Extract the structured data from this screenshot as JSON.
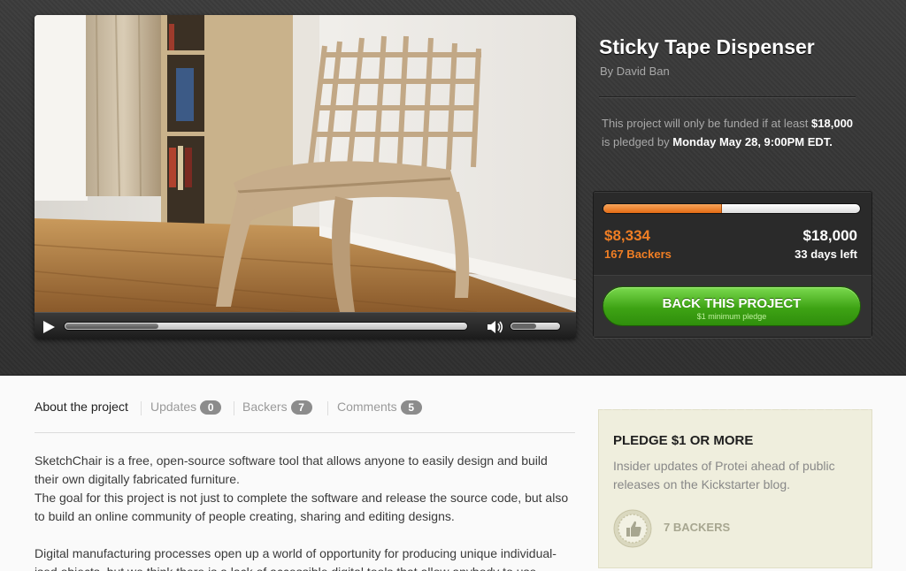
{
  "project": {
    "title": "Sticky Tape Dispenser",
    "author": "By David Ban",
    "funding_note": {
      "prefix": "This project will only be funded if at least",
      "goal_amount": "$18,000",
      "middle": "is pledged by",
      "deadline": "Monday May 28, 9:00PM EDT."
    }
  },
  "video": {
    "progress": 0.23,
    "volume": 0.5,
    "icons": {
      "play": "play-icon",
      "volume": "speaker-icon"
    }
  },
  "stats": {
    "funded_fraction": 0.463,
    "pledged": "$8,334",
    "backers": "167 Backers",
    "goal": "$18,000",
    "days_left": "33 days left"
  },
  "cta": {
    "label": "BACK THIS PROJECT",
    "sublabel": "$1 minimum pledge"
  },
  "tabs": [
    {
      "label": "About the project",
      "count": null
    },
    {
      "label": "Updates",
      "count": "0"
    },
    {
      "label": "Backers",
      "count": "7"
    },
    {
      "label": "Comments",
      "count": "5"
    }
  ],
  "description": {
    "p1": "SketchChair is a free, open-source software tool that allows anyone to easily design and build their own digitally fabricated furniture.",
    "p2": "The goal for this project is not just to complete the software and release the source code, but also to build an online community of people creating, sharing and editing designs.",
    "p3": "Digital manufacturing processes open up a world of opportunity for producing unique individual-ised objects, but we think there is a lack of accessible digital tools that allow anybody to use"
  },
  "reward": {
    "title": "PLEDGE $1 OR MORE",
    "description": "Insider updates of Protei ahead of public releases on the Kickstarter blog.",
    "backers": "7 BACKERS",
    "badge_icon": "thumbs-up-badge-icon"
  },
  "colors": {
    "accent_orange": "#f07e24",
    "cta_green": "#3ea314",
    "hero_background": "#353535"
  }
}
